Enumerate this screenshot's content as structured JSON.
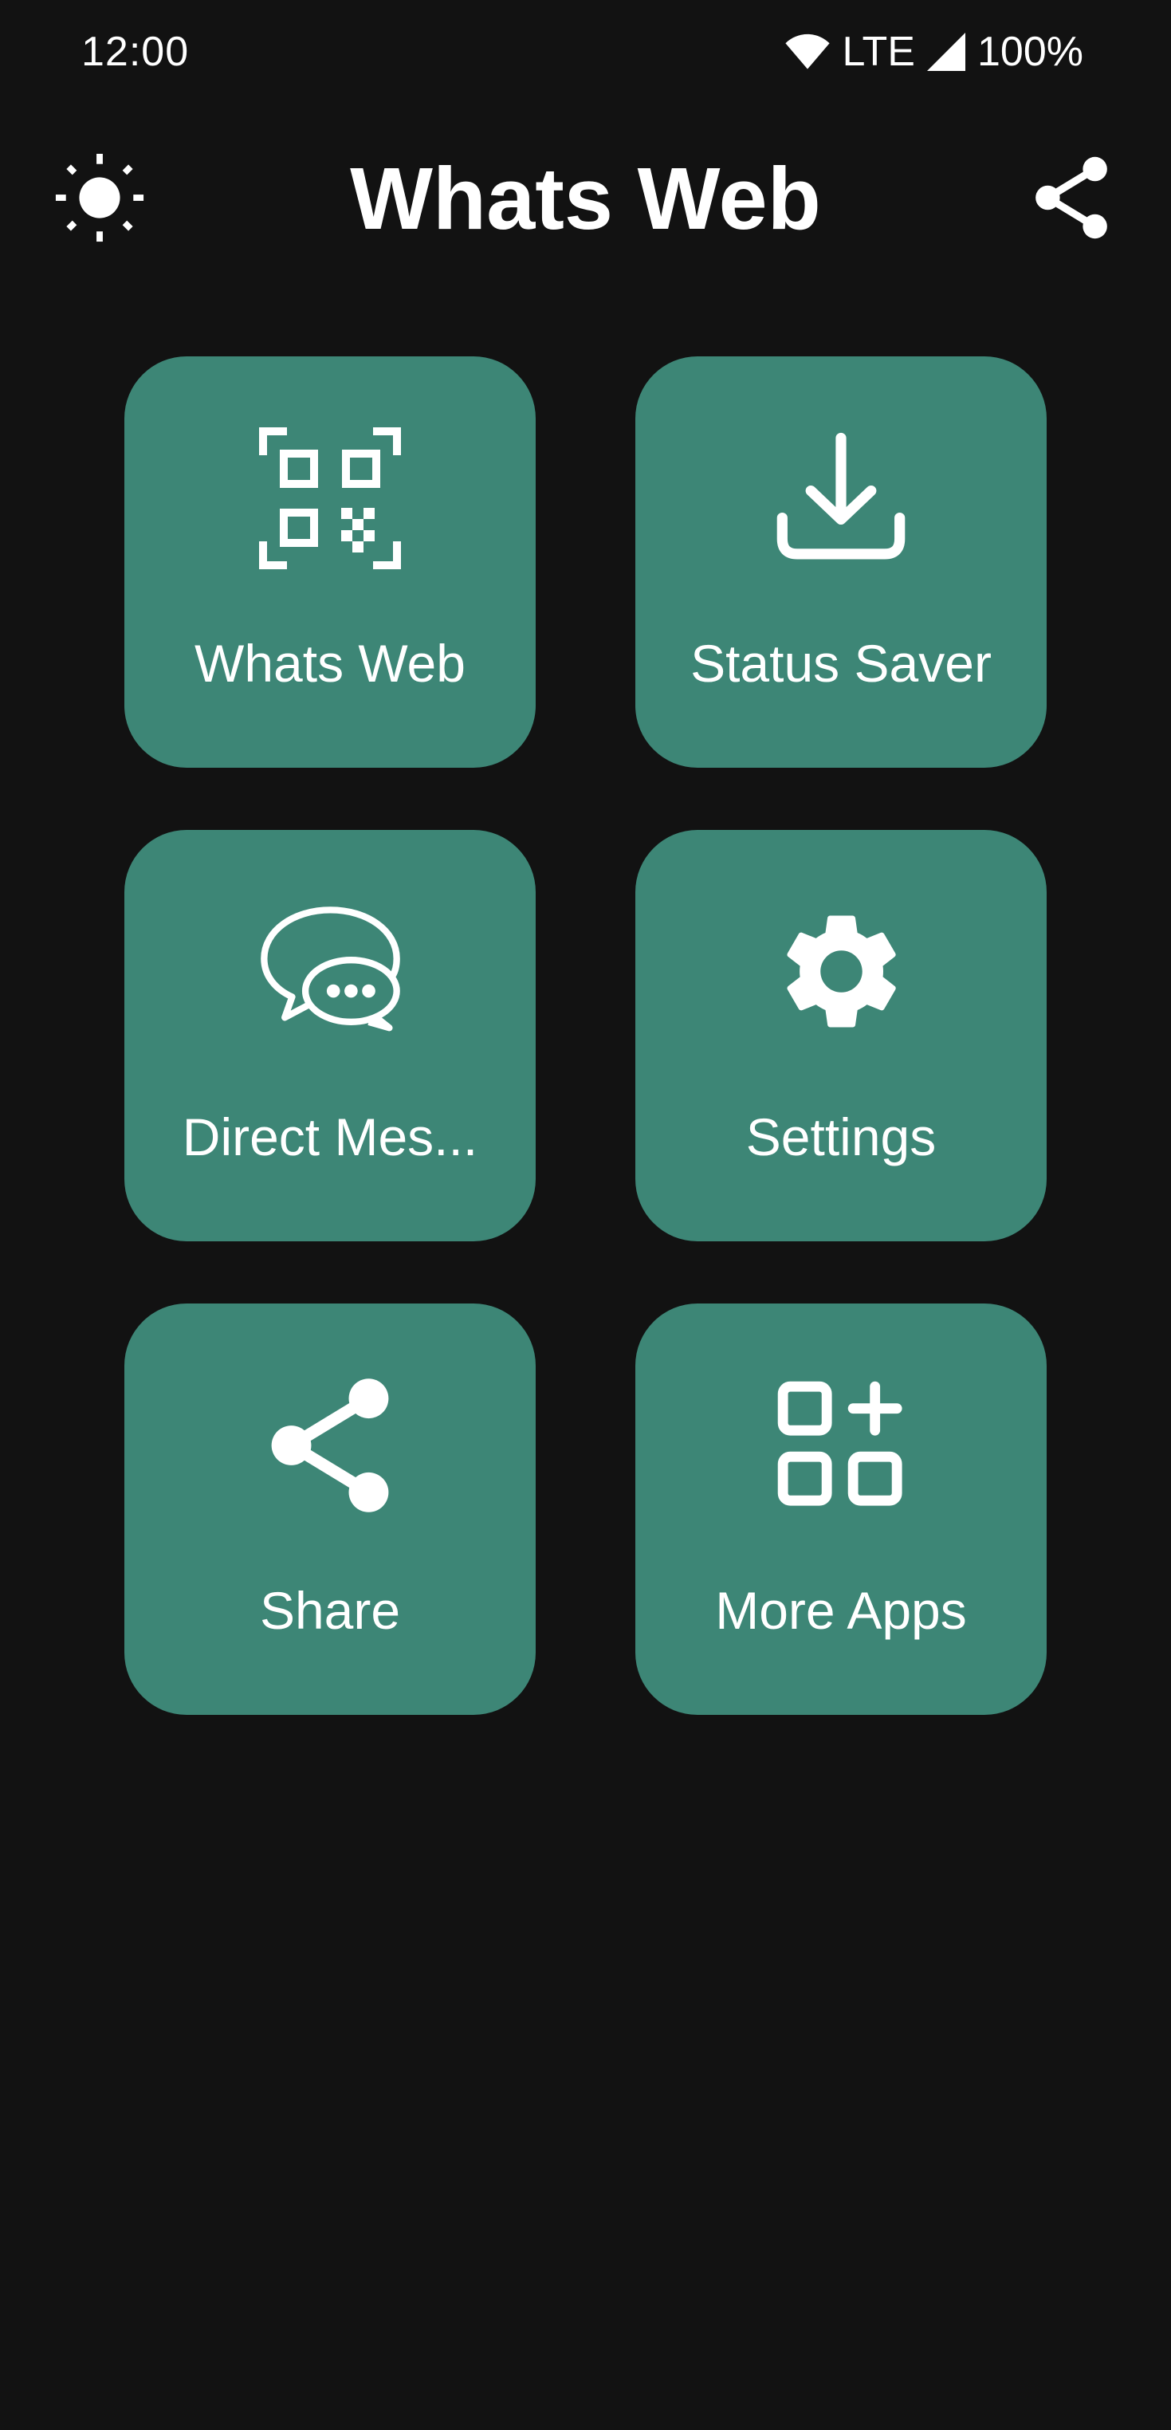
{
  "status_bar": {
    "time": "12:00",
    "network": "LTE",
    "battery": "100%",
    "icons": [
      "wifi-icon",
      "signal-icon"
    ]
  },
  "app_bar": {
    "title": "Whats Web",
    "left_icon": "brightness-icon",
    "right_icon": "share-icon"
  },
  "tiles": [
    {
      "label": "Whats Web",
      "icon": "qr-code-scan-icon"
    },
    {
      "label": "Status Saver",
      "icon": "download-icon"
    },
    {
      "label": "Direct Mes...",
      "icon": "chat-bubbles-icon"
    },
    {
      "label": "Settings",
      "icon": "gear-icon"
    },
    {
      "label": "Share",
      "icon": "share-icon"
    },
    {
      "label": "More Apps",
      "icon": "apps-add-icon"
    }
  ],
  "colors": {
    "background": "#121212",
    "tile": "#3d8676",
    "foreground": "#ffffff"
  }
}
